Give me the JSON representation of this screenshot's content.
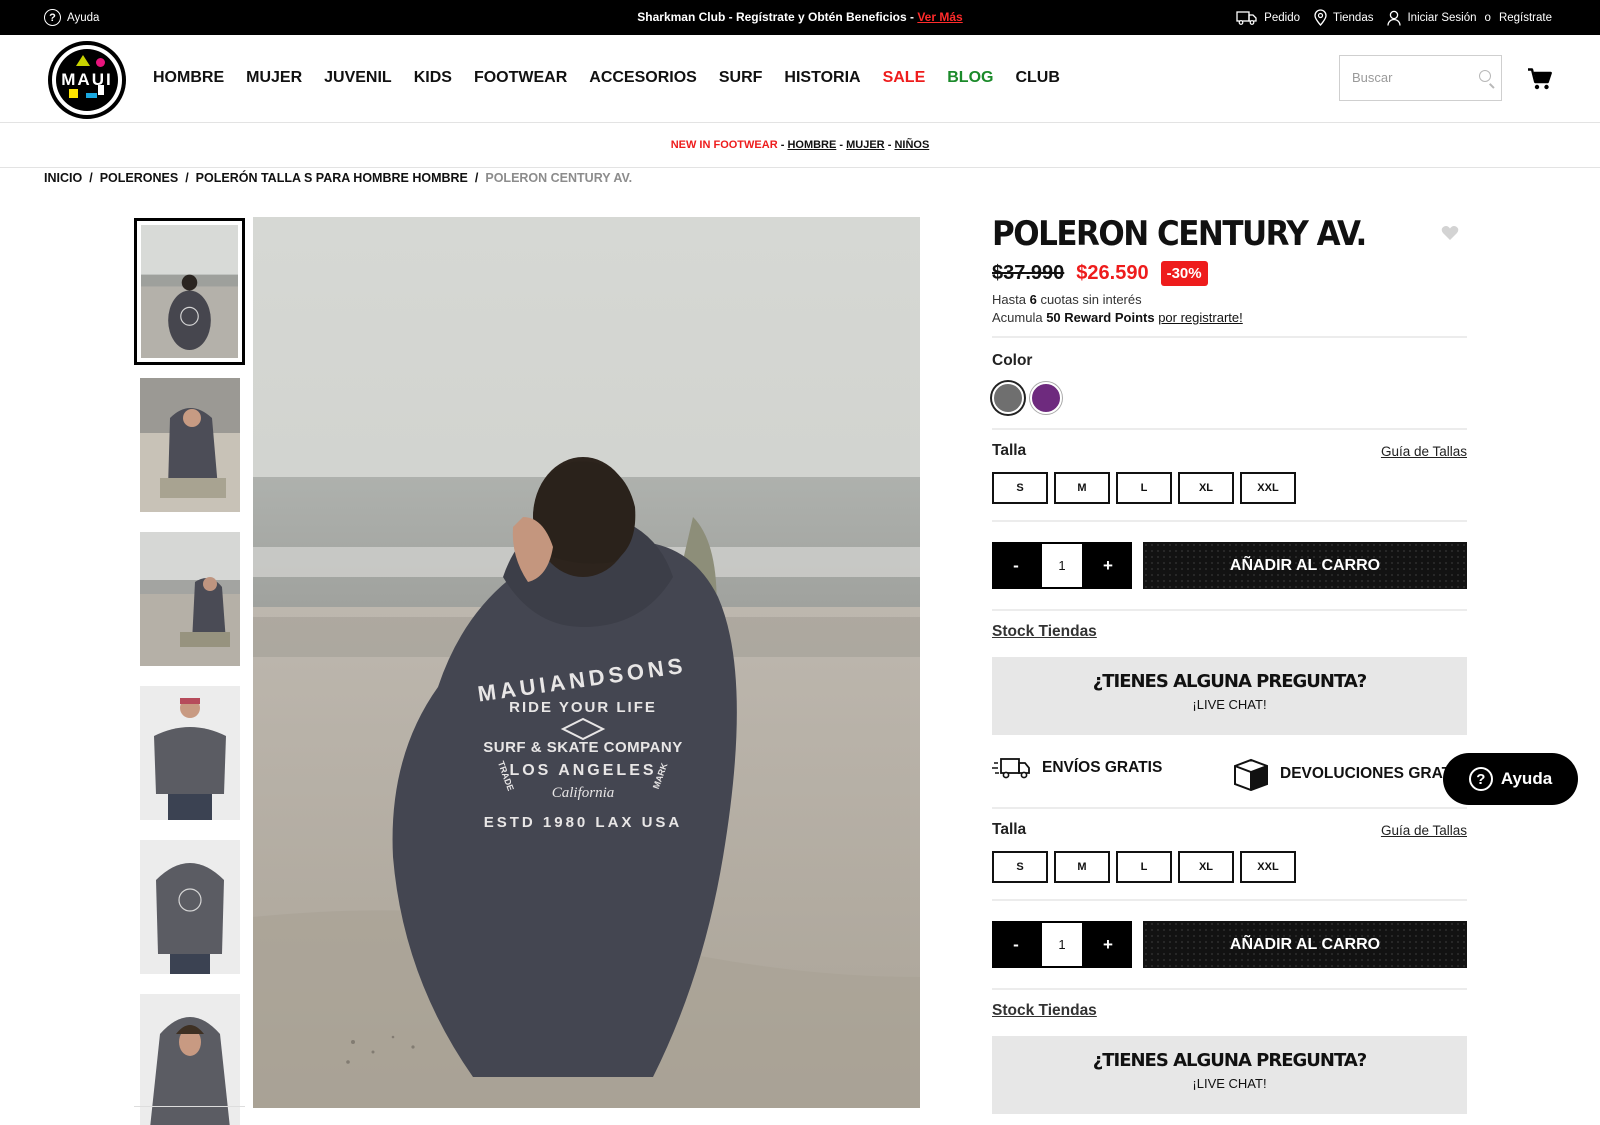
{
  "topbar": {
    "help_label": "Ayuda",
    "promo_text": "Sharkman Club - Regístrate y Obtén Beneficios -",
    "promo_link": "Ver Más",
    "order_label": "Pedido",
    "stores_label": "Tiendas",
    "login_label": "Iniciar Sesión",
    "or_label": "o",
    "register_label": "Regístrate"
  },
  "header": {
    "logo_text": "MAUI",
    "nav": [
      "HOMBRE",
      "MUJER",
      "JUVENIL",
      "KIDS",
      "FOOTWEAR",
      "ACCESORIOS",
      "SURF",
      "HISTORIA",
      "SALE",
      "BLOG",
      "CLUB"
    ],
    "search_placeholder": "Buscar"
  },
  "promo_strip": {
    "lead": "NEW IN FOOTWEAR",
    "links": [
      "HOMBRE",
      "MUJER",
      "NIÑOS"
    ],
    "separator": "-"
  },
  "breadcrumb": {
    "items": [
      "INICIO",
      "POLERONES",
      "POLERÓN TALLA S PARA HOMBRE HOMBRE"
    ],
    "current": "POLERON CENTURY AV.",
    "separator": "/"
  },
  "product": {
    "title": "POLERON CENTURY AV.",
    "old_price": "$37.990",
    "new_price": "$26.590",
    "discount": "-30%",
    "installments_pre": "Hasta",
    "installments_num": "6",
    "installments_post": "cuotas sin interés",
    "reward_pre": "Acumula",
    "reward_points": "50 Reward Points",
    "reward_link": "por registrarte!",
    "color_label": "Color",
    "colors": [
      "#6f6f6f",
      "#6e2a7e"
    ],
    "size_label": "Talla",
    "size_guide": "Guía de Tallas",
    "sizes": [
      "S",
      "M",
      "L",
      "XL",
      "XXL"
    ],
    "qty_minus": "-",
    "qty_value": "1",
    "qty_plus": "+",
    "add_to_cart": "AÑADIR AL CARRO",
    "stock_link": "Stock Tiendas",
    "faq_question": "¿TIENES ALGUNA PREGUNTA?",
    "faq_chat": "¡LIVE CHAT!",
    "free_shipping": "ENVÍOS GRATIS",
    "free_returns": "DEVOLUCIONES GRATIS"
  },
  "hoodie_print": {
    "arc_top": "MAUIANDSONS",
    "arc_mid": "RIDE YOUR LIFE",
    "line1": "SURF & SKATE COMPANY",
    "line2": "LOS ANGELES",
    "script": "California",
    "left_side": "TRADE",
    "right_side": "MARK",
    "arc_bottom": "ESTD 1980 LAX USA"
  },
  "chat_button": "Ayuda"
}
